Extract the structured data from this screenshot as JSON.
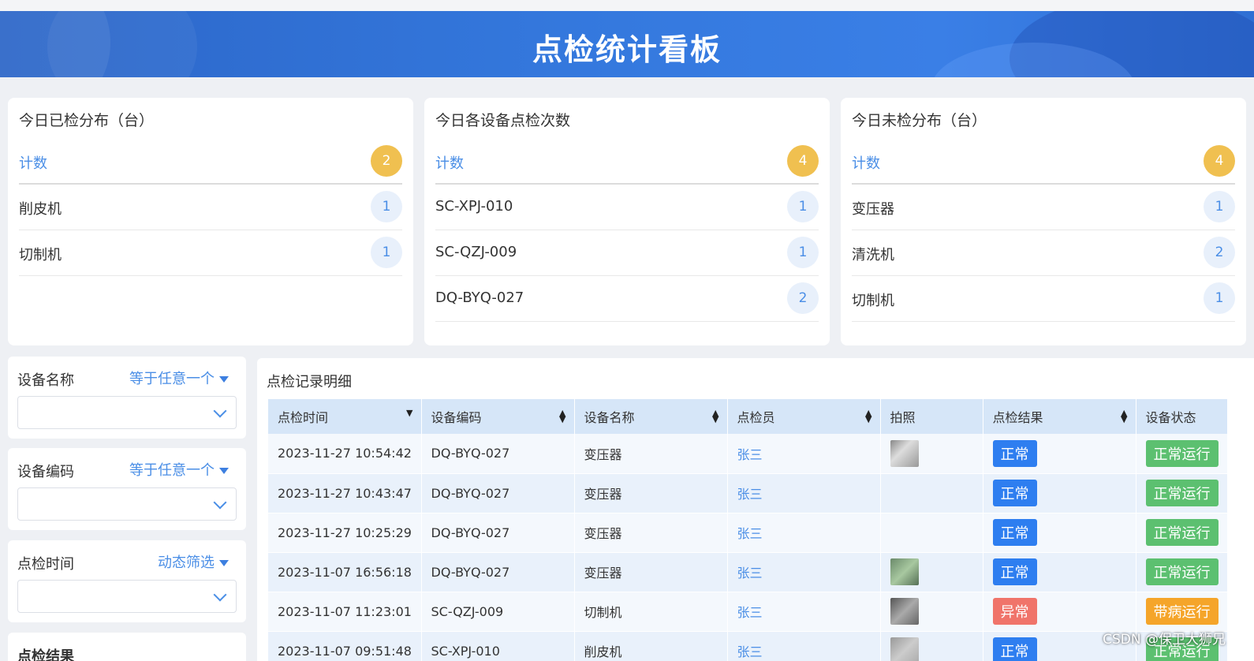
{
  "header": {
    "title": "点检统计看板"
  },
  "stats": [
    {
      "title": "今日已检分布（台）",
      "head_label": "计数",
      "head_count": "2",
      "rows": [
        {
          "label": "削皮机",
          "count": "1"
        },
        {
          "label": "切制机",
          "count": "1"
        }
      ]
    },
    {
      "title": "今日各设备点检次数",
      "head_label": "计数",
      "head_count": "4",
      "rows": [
        {
          "label": "SC-XPJ-010",
          "count": "1"
        },
        {
          "label": "SC-QZJ-009",
          "count": "1"
        },
        {
          "label": "DQ-BYQ-027",
          "count": "2"
        }
      ]
    },
    {
      "title": "今日未检分布（台）",
      "head_label": "计数",
      "head_count": "4",
      "rows": [
        {
          "label": "变压器",
          "count": "1"
        },
        {
          "label": "清洗机",
          "count": "2"
        },
        {
          "label": "切制机",
          "count": "1"
        }
      ]
    }
  ],
  "filters": [
    {
      "label": "设备名称",
      "mode": "等于任意一个",
      "value": ""
    },
    {
      "label": "设备编码",
      "mode": "等于任意一个",
      "value": ""
    },
    {
      "label": "点检时间",
      "mode": "动态筛选",
      "value": ""
    },
    {
      "label": "点检结果"
    }
  ],
  "table": {
    "title": "点检记录明细",
    "columns": [
      "点检时间",
      "设备编码",
      "设备名称",
      "点检员",
      "拍照",
      "点检结果",
      "设备状态"
    ],
    "rows": [
      {
        "time": "2023-11-27 10:54:42",
        "code": "DQ-BYQ-027",
        "name": "变压器",
        "inspector": "张三",
        "photo": "photo",
        "result": "正常",
        "status": "正常运行"
      },
      {
        "time": "2023-11-27 10:43:47",
        "code": "DQ-BYQ-027",
        "name": "变压器",
        "inspector": "张三",
        "photo": "",
        "result": "正常",
        "status": "正常运行"
      },
      {
        "time": "2023-11-27 10:25:29",
        "code": "DQ-BYQ-027",
        "name": "变压器",
        "inspector": "张三",
        "photo": "",
        "result": "正常",
        "status": "正常运行"
      },
      {
        "time": "2023-11-07 16:56:18",
        "code": "DQ-BYQ-027",
        "name": "变压器",
        "inspector": "张三",
        "photo": "photo",
        "result": "正常",
        "status": "正常运行"
      },
      {
        "time": "2023-11-07 11:23:01",
        "code": "SC-QZJ-009",
        "name": "切制机",
        "inspector": "张三",
        "photo": "photo",
        "result": "异常",
        "status": "带病运行"
      },
      {
        "time": "2023-11-07 09:51:48",
        "code": "SC-XPJ-010",
        "name": "削皮机",
        "inspector": "张三",
        "photo": "photo",
        "result": "正常",
        "status": "正常运行"
      }
    ]
  },
  "colors": {
    "header": "#3478dd",
    "accent": "#4a8ee6",
    "badge_head": "#f0c050",
    "tag_normal": "#2e7ef0",
    "tag_abnormal": "#f0746a",
    "tag_running": "#5cc070",
    "tag_sick": "#f5a52a"
  },
  "watermark": "CSDN @保卫大狮兄"
}
